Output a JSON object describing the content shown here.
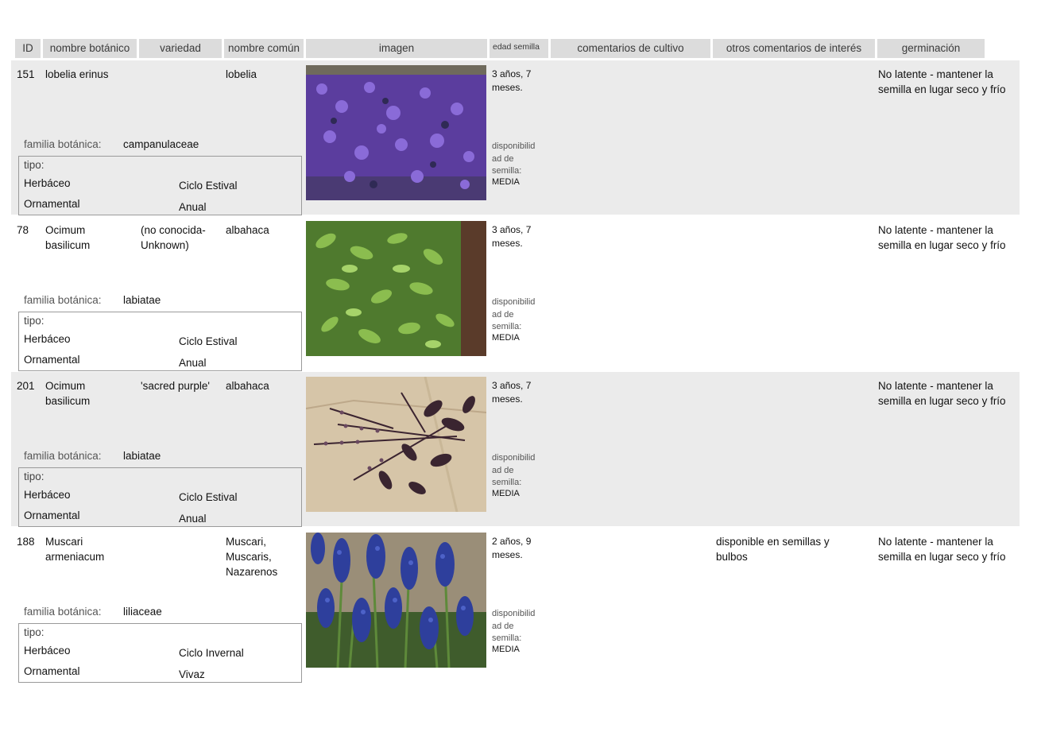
{
  "headers": {
    "id": "ID",
    "nombre_botanico": "nombre botánico",
    "variedad": "variedad",
    "nombre_comun": "nombre común",
    "imagen": "imagen",
    "edad_semilla": "edad semilla",
    "comentarios_cultivo": "comentarios de cultivo",
    "otros_comentarios": "otros comentarios de interés",
    "germinacion": "germinación"
  },
  "labels": {
    "familia": "familia botánica:",
    "tipo": "tipo:",
    "disponibilidad": "disponibilid ad de semilla:"
  },
  "rows": [
    {
      "id": "151",
      "nombre_botanico": "lobelia erinus",
      "variedad": "",
      "nombre_comun": "lobelia",
      "edad": "3  años, 7 meses.",
      "disponibilidad": "MEDIA",
      "comentarios": "",
      "otros": "",
      "germinacion": "No latente - mantener la semilla en lugar seco y frío",
      "familia": "campanulaceae",
      "tipo1": "Herbáceo",
      "tipo2": "Ornamental",
      "ciclo": "Ciclo Estival",
      "duracion": "Anual"
    },
    {
      "id": "78",
      "nombre_botanico": "Ocimum basilicum",
      "variedad": "(no conocida- Unknown)",
      "nombre_comun": "albahaca",
      "edad": "3  años, 7 meses.",
      "disponibilidad": "MEDIA",
      "comentarios": "",
      "otros": "",
      "germinacion": "No latente - mantener la semilla en lugar seco y frío",
      "familia": "labiatae",
      "tipo1": "Herbáceo",
      "tipo2": "Ornamental",
      "ciclo": "Ciclo Estival",
      "duracion": "Anual"
    },
    {
      "id": "201",
      "nombre_botanico": "Ocimum basilicum",
      "variedad": "'sacred purple'",
      "nombre_comun": "albahaca",
      "edad": "3  años, 7 meses.",
      "disponibilidad": "MEDIA",
      "comentarios": "",
      "otros": "",
      "germinacion": "No latente - mantener la semilla en lugar seco y frío",
      "familia": "labiatae",
      "tipo1": "Herbáceo",
      "tipo2": "Ornamental",
      "ciclo": "Ciclo Estival",
      "duracion": "Anual"
    },
    {
      "id": "188",
      "nombre_botanico": "Muscari armeniacum",
      "variedad": "",
      "nombre_comun": "Muscari, Muscaris, Nazarenos",
      "edad": "2  años, 9 meses.",
      "disponibilidad": "MEDIA",
      "comentarios": "",
      "otros": "disponible en semillas y bulbos",
      "germinacion": "No latente - mantener la semilla en lugar seco y frío",
      "familia": "liliaceae",
      "tipo1": "Herbáceo",
      "tipo2": "Ornamental",
      "ciclo": "Ciclo Invernal",
      "duracion": "Vivaz"
    }
  ]
}
